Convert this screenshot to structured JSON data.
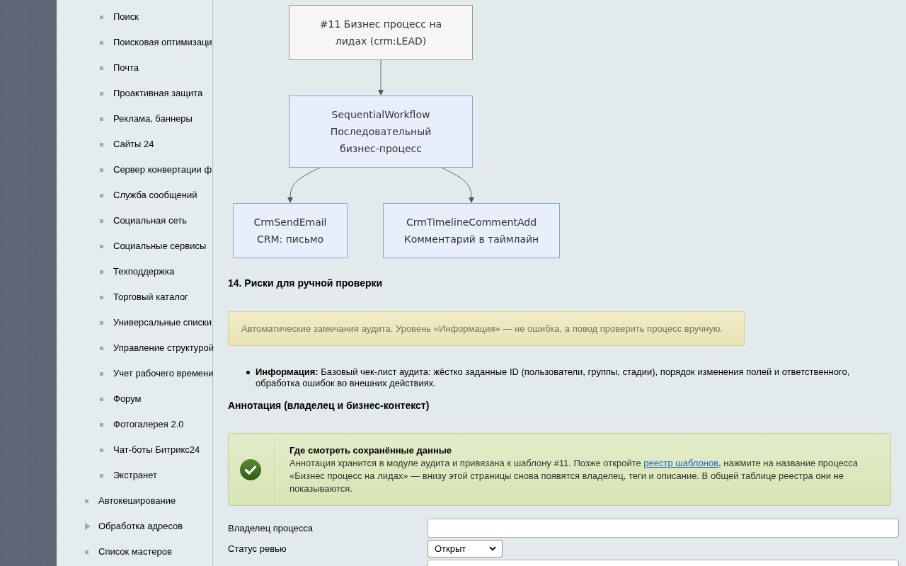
{
  "sidebar": {
    "items": [
      {
        "children": [
          {
            "label": "Поиск",
            "kind": "page"
          },
          {
            "label": "Поисковая оптимизаци",
            "kind": "page"
          },
          {
            "label": "Почта",
            "kind": "page"
          },
          {
            "label": "Проактивная защита",
            "kind": "page"
          },
          {
            "label": "Реклама, баннеры",
            "kind": "page"
          },
          {
            "label": "Сайты 24",
            "kind": "page"
          },
          {
            "label": "Сервер конвертации ф",
            "kind": "page"
          },
          {
            "label": "Служба сообщений",
            "kind": "page"
          },
          {
            "label": "Социальная сеть",
            "kind": "page"
          },
          {
            "label": "Социальные сервисы",
            "kind": "page"
          },
          {
            "label": "Техподдержка",
            "kind": "page"
          },
          {
            "label": "Торговый каталог",
            "kind": "page"
          },
          {
            "label": "Универсальные списки",
            "kind": "page"
          },
          {
            "label": "Управление структурой",
            "kind": "page"
          },
          {
            "label": "Учет рабочего времени",
            "kind": "page"
          },
          {
            "label": "Форум",
            "kind": "page"
          },
          {
            "label": "Фотогалерея 2.0",
            "kind": "page"
          },
          {
            "label": "Чат-боты Битрикс24",
            "kind": "page"
          },
          {
            "label": "Экстранет",
            "kind": "page"
          }
        ]
      },
      {
        "label": "Автокеширование",
        "kind": "page"
      },
      {
        "label": "Обработка адресов",
        "kind": "section"
      },
      {
        "label": "Список мастеров",
        "kind": "page"
      }
    ]
  },
  "diagram": {
    "nodes": [
      {
        "kind": "template",
        "label": "#11 Бизнес процесс на лидах (crm:LEAD)",
        "children": [
          {
            "kind": "activity",
            "type": "SequentialWorkflow",
            "label": "Последовательный бизнес-процесс",
            "children": [
              {
                "kind": "activity",
                "type": "CrmSendEmail",
                "label": "CRM: письмо"
              },
              {
                "kind": "activity",
                "type": "CrmTimelineCommentAdd",
                "label": "Комментарий в таймлайн"
              }
            ]
          }
        ]
      }
    ]
  },
  "risks": {
    "heading": "14. Риски для ручной проверки",
    "notice": "Автоматические замечания аудита. Уровень «Информация» — не ошибка, а повод проверить процесс вручную.",
    "items": [
      "**Информация:** Базовый чек-лист аудита: жёстко заданные ID (пользователи, группы, стадии), порядок изменения полей и ответственного, обработка ошибок во внешних действиях."
    ]
  },
  "annotation": {
    "heading": "Аннотация (владелец и бизнес-контекст)",
    "info": {
      "title": "Где смотреть сохранённые данные",
      "text_before": "Аннотация хранится в модуле аудита и привязана к шаблону #11. Позже откройте ",
      "link": "реестр шаблонов",
      "text_after": ", нажмите на название процесса «Бизнес процесс на лидах» — внизу этой страницы снова появятся владелец, теги и описание. В общей таблице реестра они не показываются."
    },
    "fields": [
      {
        "label": "Владелец процесса",
        "kind": "text"
      },
      {
        "label": "Статус ревью",
        "kind": "select",
        "value": "Открыт"
      },
      {
        "kind": "text"
      }
    ]
  }
}
